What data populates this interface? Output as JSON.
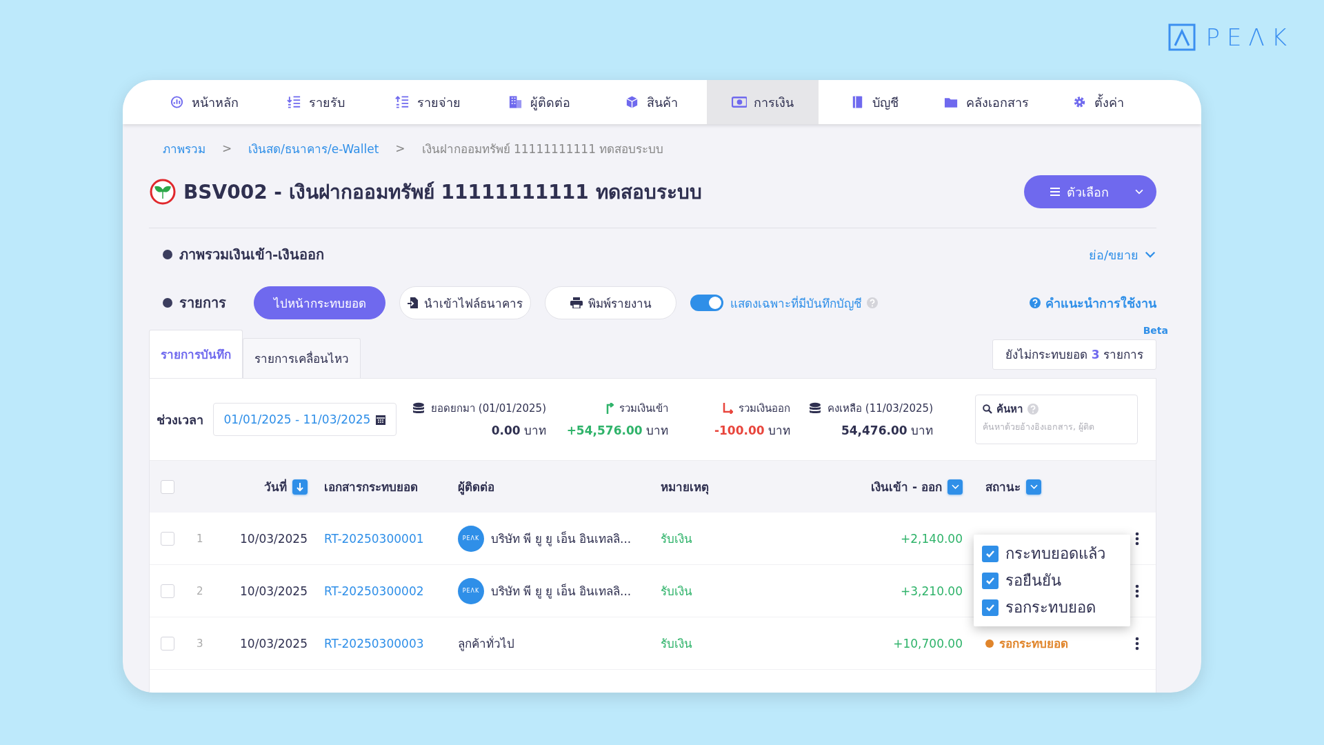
{
  "logo": {
    "text": "PEΛK"
  },
  "nav": [
    {
      "label": "หน้าหลัก",
      "selected": false
    },
    {
      "label": "รายรับ",
      "selected": false
    },
    {
      "label": "รายจ่าย",
      "selected": false
    },
    {
      "label": "ผู้ติดต่อ",
      "selected": false
    },
    {
      "label": "สินค้า",
      "selected": false
    },
    {
      "label": "การเงิน",
      "selected": true
    },
    {
      "label": "บัญชี",
      "selected": false
    },
    {
      "label": "คลังเอกสาร",
      "selected": false
    },
    {
      "label": "ตั้งค่า",
      "selected": false
    }
  ],
  "breadcrumb": {
    "separator": ">",
    "items": [
      {
        "label": "ภาพรวม",
        "link": true
      },
      {
        "label": "เงินสด/ธนาคาร/e-Wallet",
        "link": true
      },
      {
        "label": "เงินฝากออมทรัพย์ 11111111111 ทดสอบระบบ",
        "link": false
      }
    ]
  },
  "title": "BSV002 - เงินฝากออมทรัพย์ 11111111111 ทดสอบระบบ",
  "options_button": "ตัวเลือก",
  "overview": {
    "label": "ภาพรวมเงินเข้า-เงินออก",
    "toggle": "ย่อ/ขยาย"
  },
  "toolbar": {
    "label": "รายการ",
    "buttons": [
      {
        "label": "ไปหน้ากระทบยอด",
        "kind": "primary"
      },
      {
        "label": "นำเข้าไฟล์ธนาคาร",
        "kind": "import"
      },
      {
        "label": "พิมพ์รายงาน",
        "kind": "print"
      }
    ],
    "switch": {
      "label": "แสดงเฉพาะที่มีบันทึกบัญชี",
      "on": true
    },
    "help": "คำแนะนำการใช้งาน",
    "beta": "Beta"
  },
  "tabs": [
    {
      "label": "รายการบันทึก",
      "selected": true
    },
    {
      "label": "รายการเคลื่อนไหว",
      "selected": false
    }
  ],
  "unreconciled": "ยังไม่กระทบยอด **3** รายการ",
  "period": {
    "label": "ช่วงเวลา",
    "value": "01/01/2025 - 11/03/2025"
  },
  "summary": [
    {
      "label": "ยอดยกมา (01/01/2025)",
      "amount": "0.00",
      "unit": "บาท",
      "kind": "carry"
    },
    {
      "label": "รวมเงินเข้า",
      "amount": "+54,576.00",
      "unit": "บาท",
      "kind": "in"
    },
    {
      "label": "รวมเงินออก",
      "amount": "-100.00",
      "unit": "บาท",
      "kind": "out"
    },
    {
      "label": "คงเหลือ (11/03/2025)",
      "amount": "54,476.00",
      "unit": "บาท",
      "kind": "balance"
    }
  ],
  "search": {
    "label": "ค้นหา",
    "placeholder": "ค้นหาด้วยอ้างอิงเอกสาร, ผู้ติด"
  },
  "table": {
    "header_checkbox": {
      "checked": false
    },
    "columns": [
      {
        "label": "วันที่",
        "kind": "sort"
      },
      {
        "label": "เอกสารกระทบยอด",
        "kind": "plain"
      },
      {
        "label": "ผู้ติดต่อ",
        "kind": "plain"
      },
      {
        "label": "หมายเหตุ",
        "kind": "plain"
      },
      {
        "label": "เงินเข้า - ออก",
        "kind": "filter"
      },
      {
        "label": "สถานะ",
        "kind": "filter"
      }
    ],
    "rows": [
      {
        "checked": false,
        "index": "1",
        "date": "10/03/2025",
        "document": "RT-20250300001",
        "avatar": "PEΛK",
        "contact": "บริษัท พี ยู ยู เอ็น อินเทลลิ...",
        "note": "รับเงิน",
        "amount": "+2,140.00"
      },
      {
        "checked": false,
        "index": "2",
        "date": "10/03/2025",
        "document": "RT-20250300002",
        "avatar": "PEΛK",
        "contact": "บริษัท พี ยู ยู เอ็น อินเทลลิ...",
        "note": "รับเงิน",
        "amount": "+3,210.00"
      },
      {
        "checked": false,
        "index": "3",
        "date": "10/03/2025",
        "document": "RT-20250300003",
        "contact": "ลูกค้าทั่วไป",
        "note": "รับเงิน",
        "amount": "+10,700.00",
        "status": {
          "label": "รอกระทบยอด",
          "color": "#e0852b"
        }
      }
    ]
  },
  "status_filter": [
    {
      "label": "กระทบยอดแล้ว",
      "checked": true
    },
    {
      "label": "รอยืนยัน",
      "checked": true
    },
    {
      "label": "รอกระทบยอด",
      "checked": true
    }
  ]
}
